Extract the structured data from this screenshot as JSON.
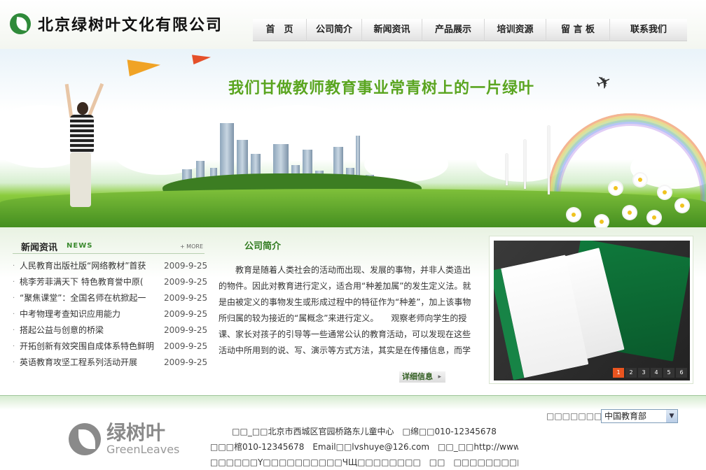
{
  "header": {
    "company_name": "北京绿树叶文化有限公司"
  },
  "nav": {
    "items": [
      {
        "label": "首　页"
      },
      {
        "label": "公司简介"
      },
      {
        "label": "新闻资讯"
      },
      {
        "label": "产品展示"
      },
      {
        "label": "培训资源"
      },
      {
        "label": "留 言 板"
      },
      {
        "label": "联系我们"
      }
    ]
  },
  "banner": {
    "slogan": "我们甘做教师教育事业常青树上的一片绿叶"
  },
  "news": {
    "title": "新闻资讯",
    "title_en": "NEWS",
    "more": "+ MORE",
    "items": [
      {
        "text": "人民教育出版社版“网络教材”首获",
        "date": "2009-9-25"
      },
      {
        "text": "桃李芳菲满天下 特色教育誉中原(",
        "date": "2009-9-25"
      },
      {
        "text": "“聚焦课堂”：全国名师在杭掀起一",
        "date": "2009-9-25"
      },
      {
        "text": "中考物理考查知识应用能力",
        "date": "2009-9-25"
      },
      {
        "text": "搭起公益与创意的桥梁",
        "date": "2009-9-25"
      },
      {
        "text": "开拓创新有效突围自成体系特色鲜明",
        "date": "2009-9-25"
      },
      {
        "text": "英语教育攻坚工程系列活动开展",
        "date": "2009-9-25"
      }
    ]
  },
  "intro": {
    "title": "公司简介",
    "body": "教育是随着人类社会的活动而出现、发展的事物，并非人类造出的物件。因此对教育进行定义，适合用“种差加属”的发生定义法。就是由被定义的事物发生或形成过程中的特征作为“种差”，加上该事物所归属的较为接近的“属概念”来进行定义。　　观察老师向学生的授课、家长对孩子的引导等一些通常公认的教育活动，可以发现在这些活动中所用到的说、写、演示等方式方法，其实是在传播信息，而学生和孩子则通过听觉、视觉、触觉等途……",
    "more_button": "详细信息"
  },
  "showcase": {
    "pages": [
      "1",
      "2",
      "3",
      "4",
      "5",
      "6"
    ],
    "active_page": "1"
  },
  "footer": {
    "logo_cn": "绿树叶",
    "logo_en": "GreenLeaves",
    "select_label": "□□□□□□□□:",
    "select_value": "中国教育部",
    "line1": "□□_□□北京市西城区官园桥路东儿童中心　□绵□□010-12345678",
    "line2": "□□□棺010-12345678　Email□□lvshuye@126.com　□□_□□http://www.lvshuye.com",
    "line3": "□□□□□□Y□□□□□□□□□□ЧЩ□□□□□□□□　□□　□□□□□□□□□□□□□□□ўђ"
  },
  "colors": {
    "brand_green": "#2f8a3a",
    "slogan_green": "#5aa520",
    "pager_active": "#e9541f"
  }
}
